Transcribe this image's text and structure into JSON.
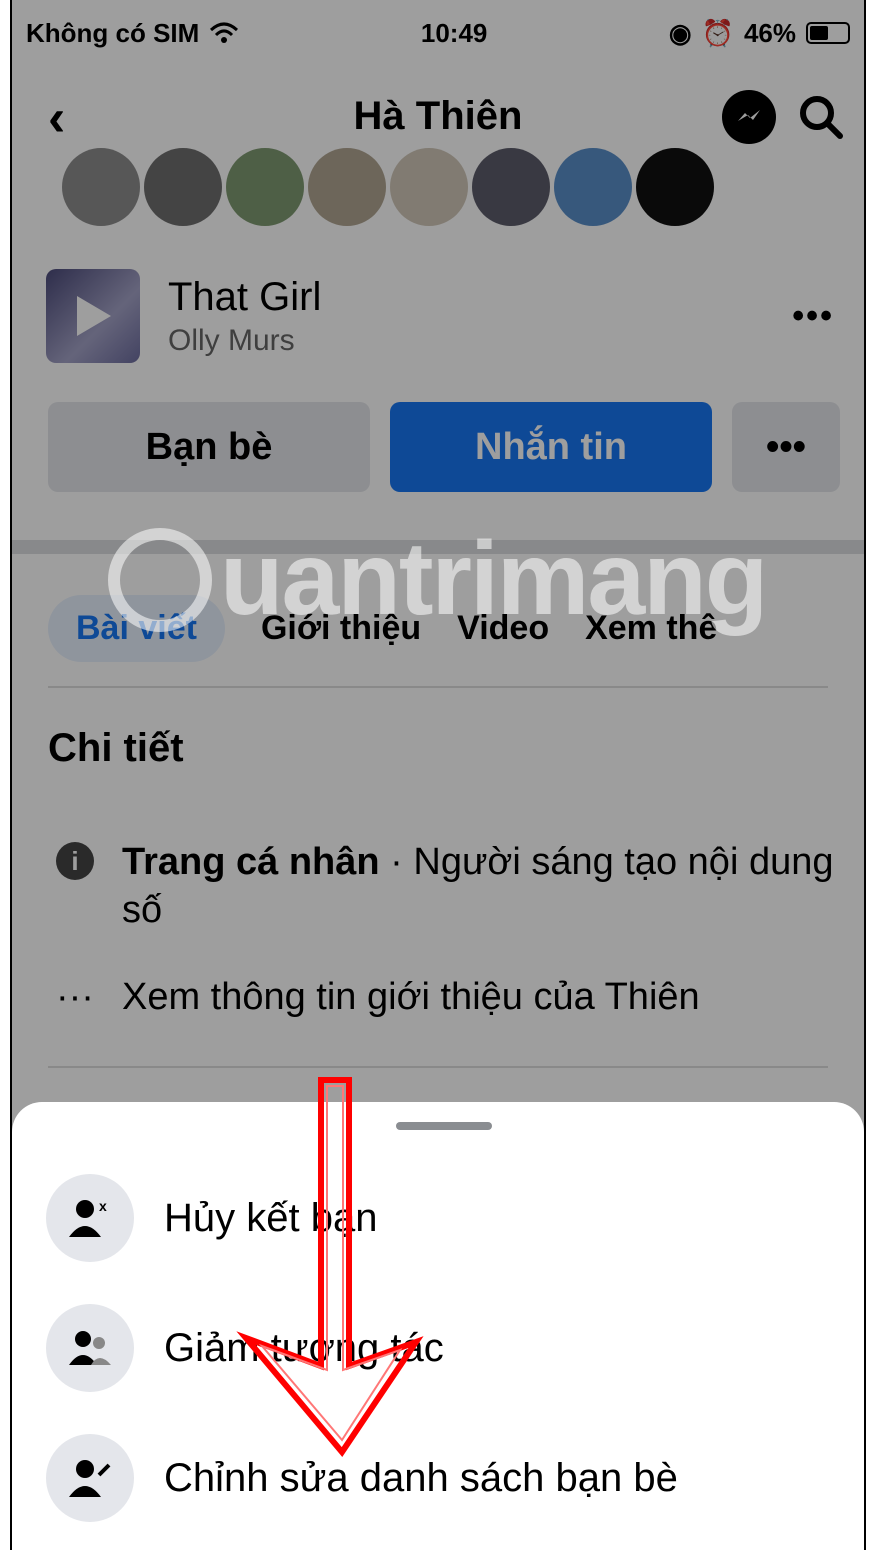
{
  "status_bar": {
    "carrier": "Không có SIM",
    "time": "10:49",
    "battery": "46%"
  },
  "header": {
    "title": "Hà Thiên",
    "icons": [
      "back-icon",
      "messenger-icon",
      "search-icon"
    ]
  },
  "music": {
    "song": "That Girl",
    "artist": "Olly Murs",
    "more": "•••"
  },
  "actions": {
    "friends": "Bạn bè",
    "message": "Nhắn tin",
    "more": "•••"
  },
  "tabs": [
    {
      "label": "Bài viết"
    },
    {
      "label": "Giới thiệu"
    },
    {
      "label": "Video"
    },
    {
      "label": "Xem thê"
    }
  ],
  "details": {
    "heading": "Chi tiết",
    "profile_type": "Trang cá nhân",
    "profile_desc": " · Người sáng tạo nội dung số",
    "see_info": "Xem thông tin giới thiệu của Thiên"
  },
  "watermark": "uantrimang",
  "sheet": {
    "items": [
      {
        "label": "Hủy kết bạn",
        "icon": "unfriend-icon"
      },
      {
        "label": "Giảm tương tác",
        "icon": "reduce-interaction-icon"
      },
      {
        "label": "Chỉnh sửa danh sách bạn bè",
        "icon": "edit-friend-list-icon"
      }
    ]
  },
  "colors": {
    "accent": "#1877f2",
    "arrow": "#ff0000"
  }
}
